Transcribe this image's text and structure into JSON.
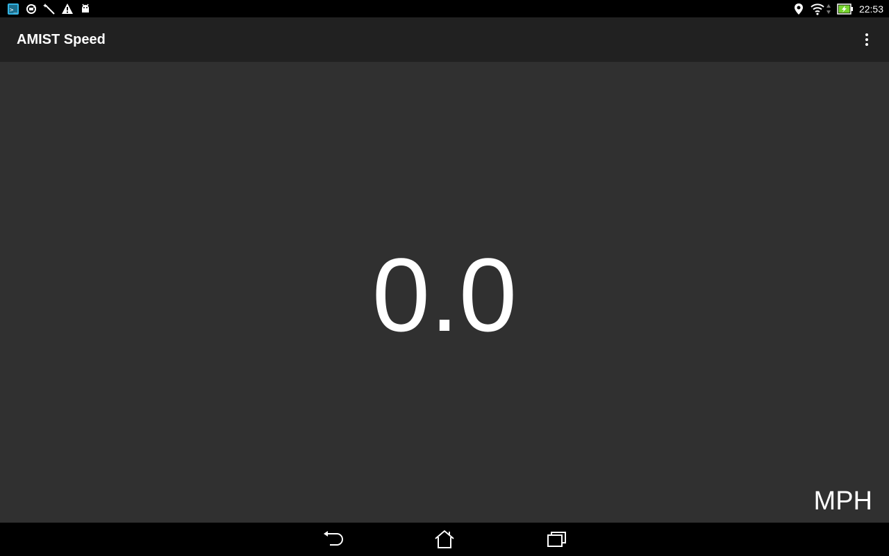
{
  "status_bar": {
    "left_icons": [
      "screenshot-icon",
      "sync-icon",
      "magic-wand-icon",
      "warning-icon",
      "android-debug-icon"
    ],
    "right_icons": [
      "location-icon",
      "wifi-icon",
      "data-arrows-icon",
      "battery-charging-icon"
    ],
    "time": "22:53",
    "battery_color": "#76d42e"
  },
  "action_bar": {
    "title": "AMIST Speed",
    "overflow_icon": "more-vert-icon"
  },
  "speedometer": {
    "speed": "0.0",
    "unit": "MPH"
  },
  "nav_bar": {
    "buttons": [
      "back-icon",
      "home-icon",
      "recents-icon"
    ]
  }
}
